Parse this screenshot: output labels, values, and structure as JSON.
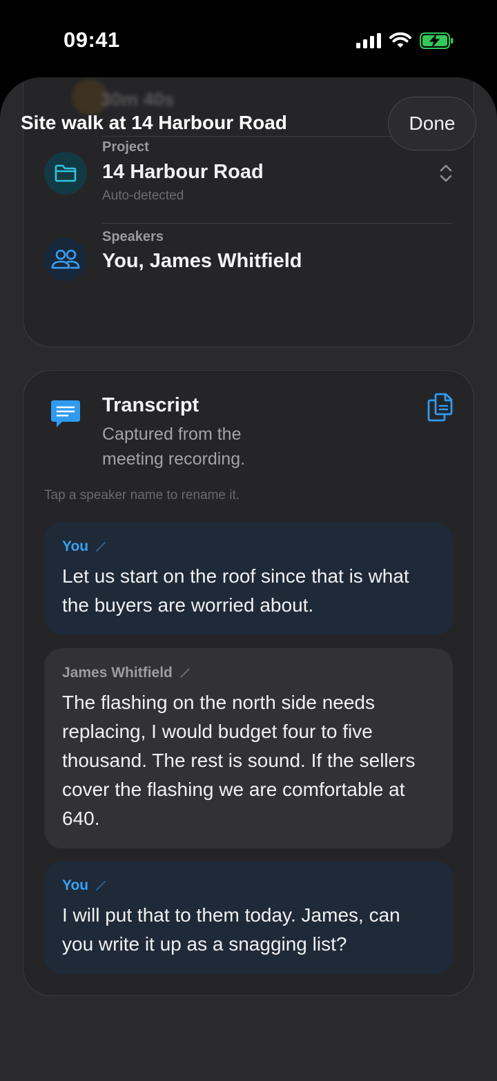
{
  "status": {
    "time": "09:41"
  },
  "header": {
    "title": "Site walk at 14 Harbour Road",
    "done_label": "Done"
  },
  "summary": {
    "duration_value": "30m 40s",
    "project_label": "Project",
    "project_value": "14 Harbour Road",
    "project_sub": "Auto-detected",
    "speakers_label": "Speakers",
    "speakers_value": "You, James Whitfield"
  },
  "transcript": {
    "title": "Transcript",
    "subtitle": "Captured from the meeting recording.",
    "hint": "Tap a speaker name to rename it.",
    "entries": [
      {
        "speaker": "You",
        "text": "Let us start on the roof since that is what the buyers are worried about."
      },
      {
        "speaker": "James Whitfield",
        "text": "The flashing on the north side needs replacing, I would budget four to five thousand. The rest is sound. If the sellers cover the flashing we are comfortable at 640."
      },
      {
        "speaker": "You",
        "text": "I will put that to them today. James, can you write it up as a snagging list?"
      }
    ]
  },
  "colors": {
    "accent": "#3aa0f2",
    "project_icon": "#33c3dd",
    "battery": "#34c759"
  }
}
